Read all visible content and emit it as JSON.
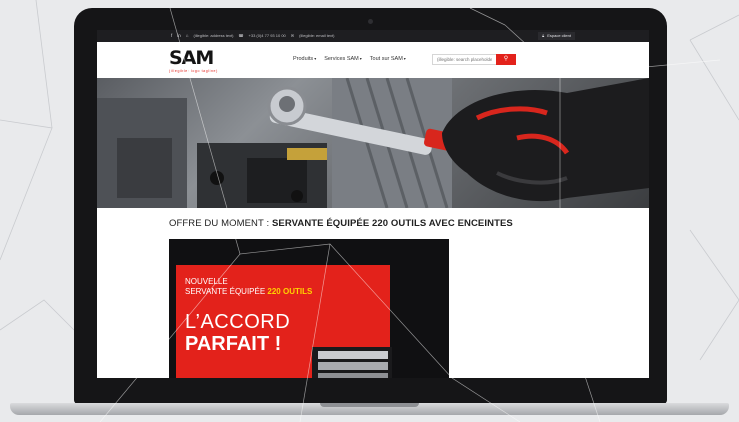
{
  "topbar": {
    "social": [
      "f",
      "in",
      "⌂"
    ],
    "address": "(illegible: address text)",
    "phone": "+33 (0)4 77 93 10 00",
    "email": "(illegible: email text)",
    "client_label": "Espace client"
  },
  "header": {
    "logo_text": "SAM",
    "logo_tagline": "(illegible: logo tagline)",
    "nav": [
      {
        "label": "Produits"
      },
      {
        "label": "Services SAM"
      },
      {
        "label": "Tout sur SAM"
      }
    ],
    "search_placeholder": "(illegible: search placeholder)"
  },
  "offer": {
    "prefix": "OFFRE DU MOMENT : ",
    "title": "SERVANTE ÉQUIPÉE 220 OUTILS AVEC ENCEINTES"
  },
  "promo": {
    "line1": "NOUVELLE",
    "line2_pre": "SERVANTE ÉQUIPÉE ",
    "line2_highlight": "220 OUTILS",
    "line3": "L’ACCORD",
    "line4": "PARFAIT !"
  },
  "colors": {
    "brand_red": "#e3221b",
    "topbar_bg": "#1e1e21",
    "highlight_yellow": "#ffd200"
  }
}
